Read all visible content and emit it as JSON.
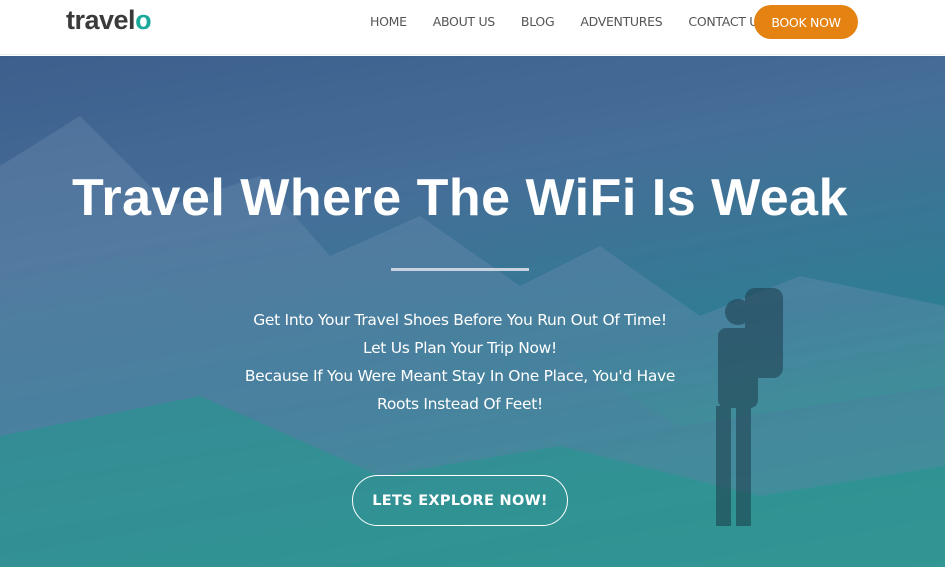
{
  "brand": {
    "logo_main": "travel",
    "logo_accent": "o",
    "accent_color": "#1aa99a"
  },
  "nav": {
    "items": [
      "HOME",
      "ABOUT US",
      "BLOG",
      "ADVENTURES",
      "CONTACT US"
    ],
    "book_label": "BOOK NOW",
    "book_color": "#e58312"
  },
  "hero": {
    "title": "Travel Where The WiFi Is Weak",
    "lines": [
      "Get Into Your Travel Shoes Before You Run Out Of Time!",
      "Let Us Plan Your Trip Now!",
      "Because If You Were Meant Stay In One Place, You'd Have",
      "Roots Instead Of Feet!"
    ],
    "cta_label": "LETS EXPLORE NOW!"
  }
}
